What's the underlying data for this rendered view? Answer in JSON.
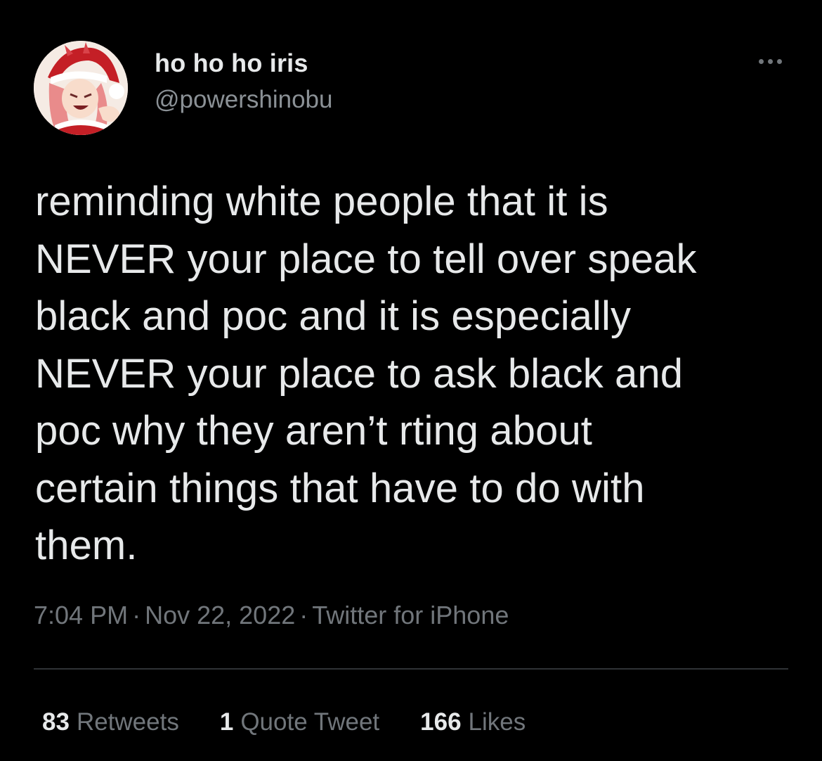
{
  "user": {
    "display_name": "ho ho ho iris",
    "handle": "@powershinobu",
    "avatar_icon": "profile-avatar-image"
  },
  "menu": {
    "icon": "more-options-icon"
  },
  "tweet": {
    "text": "reminding white people that it is\nNEVER your place to tell over speak\nblack and poc and it is especially\nNEVER your place to ask black and\npoc why they aren’t rting about\ncertain things that have to do with\nthem."
  },
  "meta": {
    "time": "7:04 PM",
    "separator": "·",
    "date": "Nov 22, 2022",
    "source": "Twitter for iPhone"
  },
  "stats": {
    "retweets": {
      "count": "83",
      "label": "Retweets"
    },
    "quotes": {
      "count": "1",
      "label": "Quote Tweet"
    },
    "likes": {
      "count": "166",
      "label": "Likes"
    }
  },
  "colors": {
    "background": "#000000",
    "primary_text": "#e7e9ea",
    "secondary_text": "#71767b",
    "divider": "#2f3336"
  }
}
